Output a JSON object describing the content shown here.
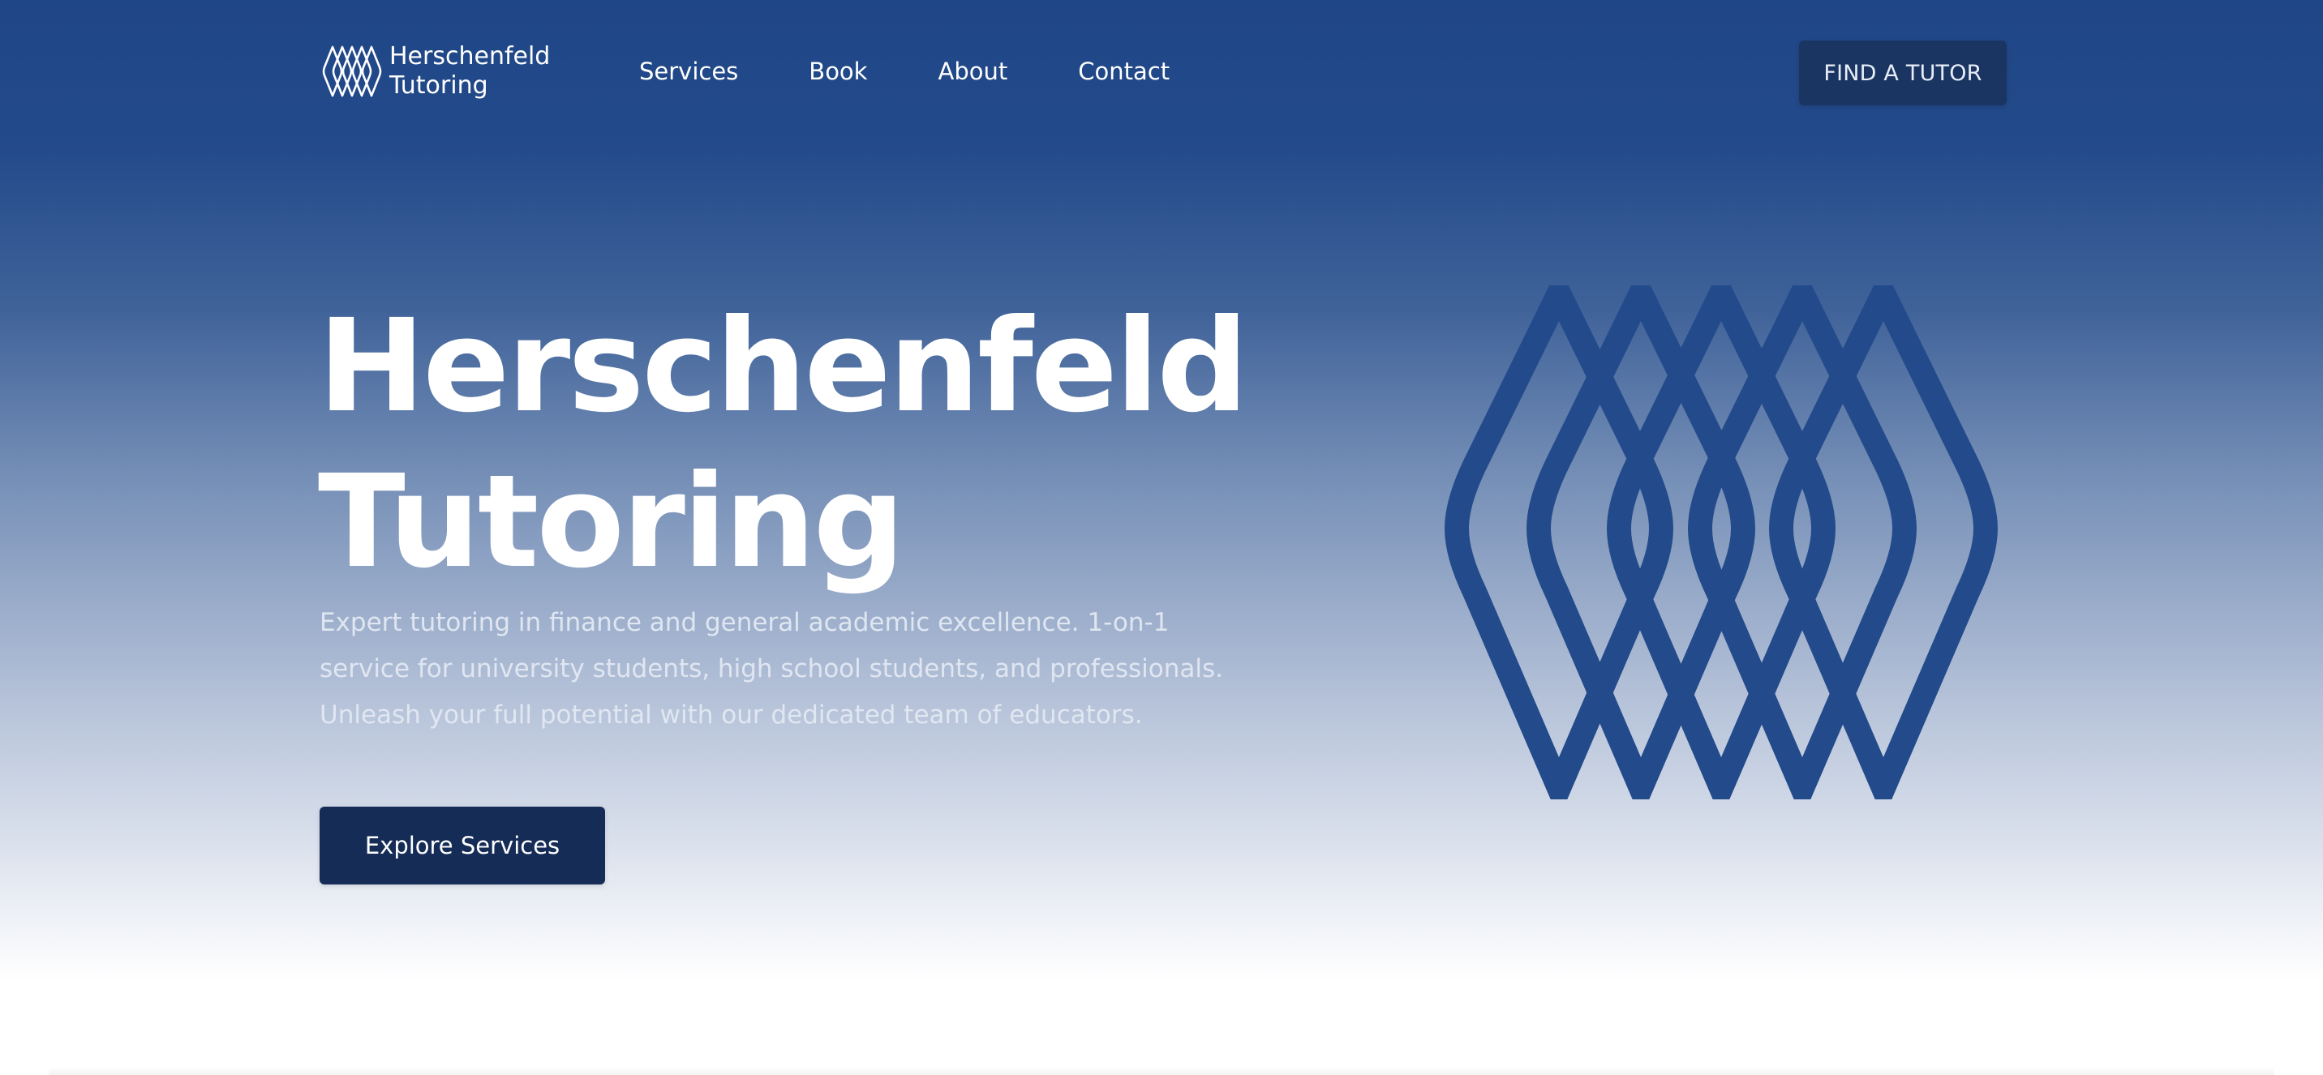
{
  "brand": {
    "name_line1": "Herschenfeld",
    "name_line2": "Tutoring",
    "logo_icon": "lattice-logo-icon"
  },
  "nav": {
    "items": [
      {
        "label": "Services"
      },
      {
        "label": "Book"
      },
      {
        "label": "About"
      },
      {
        "label": "Contact"
      }
    ]
  },
  "header_cta": {
    "label": "FIND A TUTOR"
  },
  "hero": {
    "title_line1": "Herschenfeld",
    "title_line2": "Tutoring",
    "description": "Expert tutoring in finance and general academic excellence. 1-on-1 service for university students, high school students, and professionals. Unleash your full potential with our dedicated team of educators.",
    "button_label": "Explore Services",
    "art_icon": "lattice-emblem-icon"
  },
  "colors": {
    "brand_blue": "#1f4686",
    "button_navy": "#152c56",
    "emblem_blue": "#234a8a",
    "text_white": "#ffffff"
  }
}
